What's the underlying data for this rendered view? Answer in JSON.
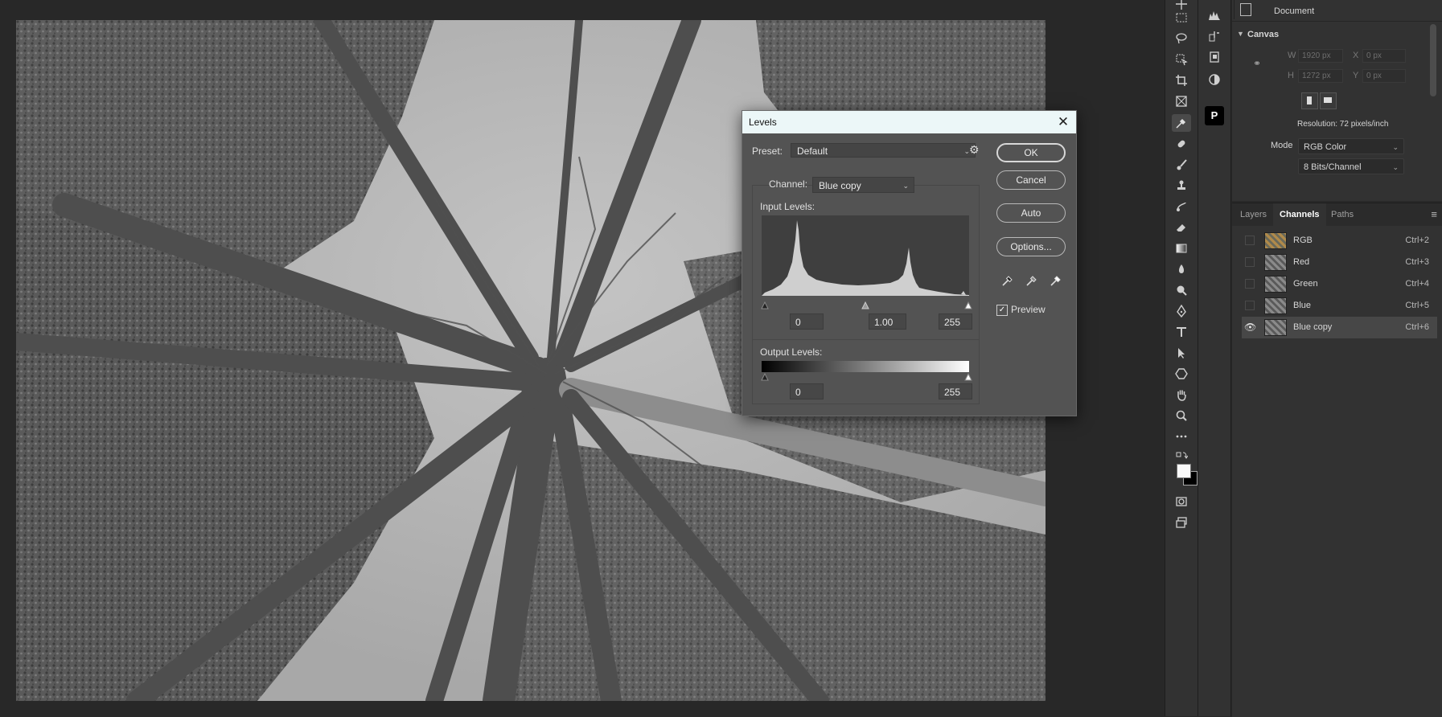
{
  "properties": {
    "document_label": "Document",
    "canvas_label": "Canvas",
    "w_label": "W",
    "w_value": "1920 px",
    "x_label": "X",
    "x_value": "0 px",
    "h_label": "H",
    "h_value": "1272 px",
    "y_label": "Y",
    "y_value": "0 px",
    "resolution": "Resolution: 72 pixels/inch",
    "mode_label": "Mode",
    "mode_value": "RGB Color",
    "depth_value": "8 Bits/Channel"
  },
  "panel_tabs": [
    "Layers",
    "Channels",
    "Paths"
  ],
  "channels": [
    {
      "name": "RGB",
      "shortcut": "Ctrl+2"
    },
    {
      "name": "Red",
      "shortcut": "Ctrl+3"
    },
    {
      "name": "Green",
      "shortcut": "Ctrl+4"
    },
    {
      "name": "Blue",
      "shortcut": "Ctrl+5"
    },
    {
      "name": "Blue copy",
      "shortcut": "Ctrl+6"
    }
  ],
  "dialog": {
    "title": "Levels",
    "preset_label": "Preset:",
    "preset_value": "Default",
    "channel_label": "Channel:",
    "channel_value": "Blue copy",
    "input_levels_label": "Input Levels:",
    "input_black": "0",
    "input_gamma": "1.00",
    "input_white": "255",
    "output_levels_label": "Output Levels:",
    "output_black": "0",
    "output_white": "255",
    "ok": "OK",
    "cancel": "Cancel",
    "auto": "Auto",
    "options": "Options...",
    "preview_label": "Preview",
    "preview_checked": true
  },
  "colors": {
    "app_bg": "#282828",
    "panel_bg": "#323232",
    "dialog_bg": "#535353",
    "dialog_title_bg": "#ecf7f8",
    "selected_row": "#474747"
  },
  "tools": [
    "move-tool",
    "marquee-tool",
    "lasso-tool",
    "object-select-tool",
    "crop-tool",
    "frame-tool",
    "eyedropper-tool",
    "healing-tool",
    "brush-tool",
    "stamp-tool",
    "history-brush-tool",
    "eraser-tool",
    "gradient-tool",
    "blur-tool",
    "dodge-tool",
    "pen-tool",
    "type-tool",
    "path-select-tool",
    "shape-tool",
    "hand-tool",
    "zoom-tool",
    "more-tools"
  ]
}
